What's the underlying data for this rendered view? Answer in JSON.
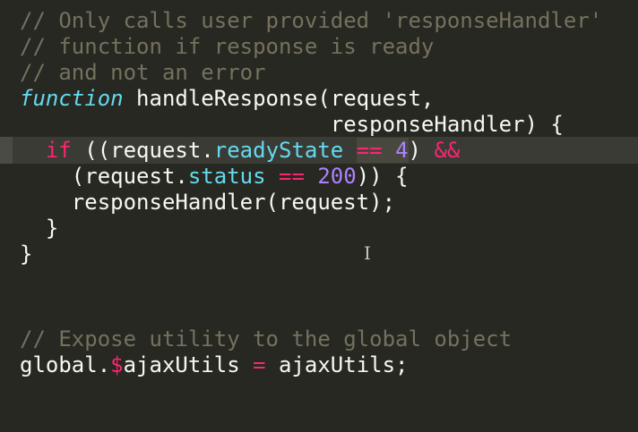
{
  "editor": {
    "theme": {
      "background": "#272822",
      "foreground": "#f8f8f2",
      "comment": "#75715e",
      "keyword": "#f92672",
      "property": "#66d9ef",
      "number": "#ae81ff",
      "selection": "#49483e"
    },
    "lines": [
      {
        "comment": "// Only calls user provided 'responseHandler'"
      },
      {
        "comment": "// function if response is ready"
      },
      {
        "comment": "// and not an error"
      },
      {
        "keyword": "function",
        "rest": " handleResponse(request,"
      },
      {
        "text": "                        responseHandler) {"
      },
      {
        "indent": "  ",
        "keyword": "if",
        "t1": " ((request.",
        "prop": "readyState",
        "t2": " ",
        "op": "==",
        "t3": " ",
        "num": "4",
        "t4": ") ",
        "op2": "&&"
      },
      {
        "indent": "    (request.",
        "prop": "status",
        "t1": " ",
        "op": "==",
        "t2": " ",
        "num": "200",
        "t3": ")) {"
      },
      {
        "text": "    responseHandler(request);"
      },
      {
        "text": "  }"
      },
      {
        "text": "}"
      },
      {
        "text": ""
      },
      {
        "text": ""
      },
      {
        "comment": "// Expose utility to the global object"
      },
      {
        "t1": "global.",
        "dollar": "$",
        "t2": "ajaxUtils ",
        "op": "=",
        "t3": " ajaxUtils;"
      }
    ]
  },
  "mouse_cursor": {
    "icon": "text-cursor-icon",
    "glyph": "I"
  }
}
